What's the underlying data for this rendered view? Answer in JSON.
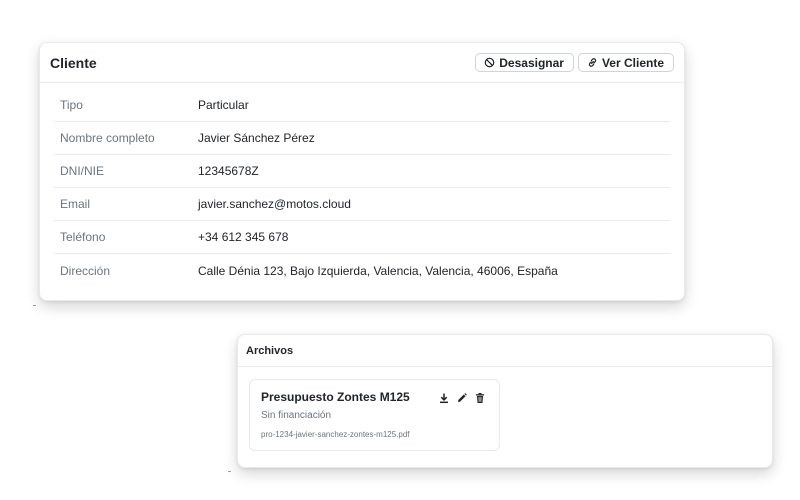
{
  "client_card": {
    "title": "Cliente",
    "actions": {
      "unassign_label": "Desasignar",
      "view_label": "Ver Cliente"
    },
    "rows": [
      {
        "label": "Tipo",
        "value": "Particular"
      },
      {
        "label": "Nombre completo",
        "value": "Javier Sánchez Pérez"
      },
      {
        "label": "DNI/NIE",
        "value": "12345678Z"
      },
      {
        "label": "Email",
        "value": "javier.sanchez@motos.cloud"
      },
      {
        "label": "Teléfono",
        "value": "+34 612 345 678"
      },
      {
        "label": "Dirección",
        "value": "Calle Dénia 123, Bajo Izquierda, Valencia, Valencia, 46006, España"
      }
    ]
  },
  "files_card": {
    "title": "Archivos",
    "files": [
      {
        "title": "Presupuesto Zontes M125",
        "subtitle": "Sin financiación",
        "filename": "pro-1234-javier-sanchez-zontes-m125.pdf",
        "icons": [
          "download-icon",
          "edit-icon",
          "delete-icon"
        ]
      }
    ]
  },
  "colors": {
    "text": "#212529",
    "muted": "#6c757d",
    "border": "#e9ecef",
    "background": "#ffffff"
  }
}
